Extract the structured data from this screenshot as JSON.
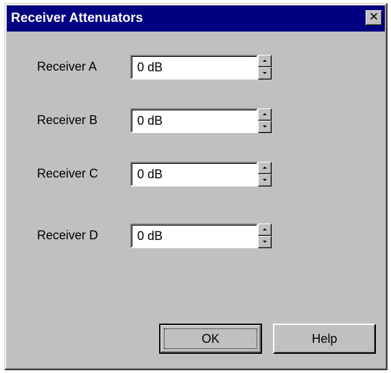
{
  "window": {
    "title": "Receiver Attenuators",
    "close_glyph": "✕"
  },
  "receivers": [
    {
      "label": "Receiver A",
      "value": "0 dB"
    },
    {
      "label": "Receiver B",
      "value": "0 dB"
    },
    {
      "label": "Receiver C",
      "value": "0 dB"
    },
    {
      "label": "Receiver D",
      "value": "0 dB"
    }
  ],
  "buttons": {
    "ok_label": "OK",
    "help_label": "Help"
  },
  "icons": {
    "close": "close-icon",
    "spin_up": "chevron-up-icon",
    "spin_down": "chevron-down-icon"
  },
  "colors": {
    "titlebar": "#000080",
    "face": "#c0c0c0",
    "field": "#ffffff"
  }
}
